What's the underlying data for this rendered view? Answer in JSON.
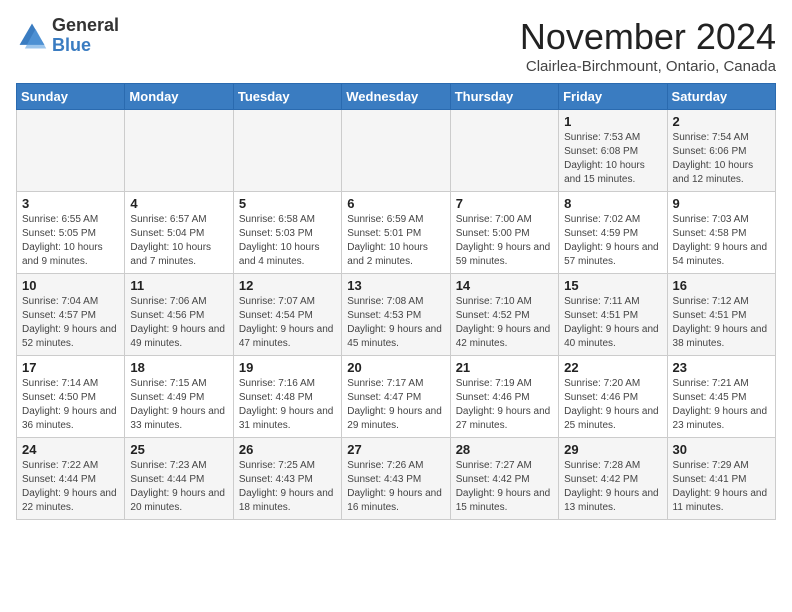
{
  "app": {
    "logo_general": "General",
    "logo_blue": "Blue"
  },
  "header": {
    "title": "November 2024",
    "location": "Clairlea-Birchmount, Ontario, Canada"
  },
  "columns": [
    "Sunday",
    "Monday",
    "Tuesday",
    "Wednesday",
    "Thursday",
    "Friday",
    "Saturday"
  ],
  "weeks": [
    [
      {
        "day": "",
        "info": ""
      },
      {
        "day": "",
        "info": ""
      },
      {
        "day": "",
        "info": ""
      },
      {
        "day": "",
        "info": ""
      },
      {
        "day": "",
        "info": ""
      },
      {
        "day": "1",
        "info": "Sunrise: 7:53 AM\nSunset: 6:08 PM\nDaylight: 10 hours and 15 minutes."
      },
      {
        "day": "2",
        "info": "Sunrise: 7:54 AM\nSunset: 6:06 PM\nDaylight: 10 hours and 12 minutes."
      }
    ],
    [
      {
        "day": "3",
        "info": "Sunrise: 6:55 AM\nSunset: 5:05 PM\nDaylight: 10 hours and 9 minutes."
      },
      {
        "day": "4",
        "info": "Sunrise: 6:57 AM\nSunset: 5:04 PM\nDaylight: 10 hours and 7 minutes."
      },
      {
        "day": "5",
        "info": "Sunrise: 6:58 AM\nSunset: 5:03 PM\nDaylight: 10 hours and 4 minutes."
      },
      {
        "day": "6",
        "info": "Sunrise: 6:59 AM\nSunset: 5:01 PM\nDaylight: 10 hours and 2 minutes."
      },
      {
        "day": "7",
        "info": "Sunrise: 7:00 AM\nSunset: 5:00 PM\nDaylight: 9 hours and 59 minutes."
      },
      {
        "day": "8",
        "info": "Sunrise: 7:02 AM\nSunset: 4:59 PM\nDaylight: 9 hours and 57 minutes."
      },
      {
        "day": "9",
        "info": "Sunrise: 7:03 AM\nSunset: 4:58 PM\nDaylight: 9 hours and 54 minutes."
      }
    ],
    [
      {
        "day": "10",
        "info": "Sunrise: 7:04 AM\nSunset: 4:57 PM\nDaylight: 9 hours and 52 minutes."
      },
      {
        "day": "11",
        "info": "Sunrise: 7:06 AM\nSunset: 4:56 PM\nDaylight: 9 hours and 49 minutes."
      },
      {
        "day": "12",
        "info": "Sunrise: 7:07 AM\nSunset: 4:54 PM\nDaylight: 9 hours and 47 minutes."
      },
      {
        "day": "13",
        "info": "Sunrise: 7:08 AM\nSunset: 4:53 PM\nDaylight: 9 hours and 45 minutes."
      },
      {
        "day": "14",
        "info": "Sunrise: 7:10 AM\nSunset: 4:52 PM\nDaylight: 9 hours and 42 minutes."
      },
      {
        "day": "15",
        "info": "Sunrise: 7:11 AM\nSunset: 4:51 PM\nDaylight: 9 hours and 40 minutes."
      },
      {
        "day": "16",
        "info": "Sunrise: 7:12 AM\nSunset: 4:51 PM\nDaylight: 9 hours and 38 minutes."
      }
    ],
    [
      {
        "day": "17",
        "info": "Sunrise: 7:14 AM\nSunset: 4:50 PM\nDaylight: 9 hours and 36 minutes."
      },
      {
        "day": "18",
        "info": "Sunrise: 7:15 AM\nSunset: 4:49 PM\nDaylight: 9 hours and 33 minutes."
      },
      {
        "day": "19",
        "info": "Sunrise: 7:16 AM\nSunset: 4:48 PM\nDaylight: 9 hours and 31 minutes."
      },
      {
        "day": "20",
        "info": "Sunrise: 7:17 AM\nSunset: 4:47 PM\nDaylight: 9 hours and 29 minutes."
      },
      {
        "day": "21",
        "info": "Sunrise: 7:19 AM\nSunset: 4:46 PM\nDaylight: 9 hours and 27 minutes."
      },
      {
        "day": "22",
        "info": "Sunrise: 7:20 AM\nSunset: 4:46 PM\nDaylight: 9 hours and 25 minutes."
      },
      {
        "day": "23",
        "info": "Sunrise: 7:21 AM\nSunset: 4:45 PM\nDaylight: 9 hours and 23 minutes."
      }
    ],
    [
      {
        "day": "24",
        "info": "Sunrise: 7:22 AM\nSunset: 4:44 PM\nDaylight: 9 hours and 22 minutes."
      },
      {
        "day": "25",
        "info": "Sunrise: 7:23 AM\nSunset: 4:44 PM\nDaylight: 9 hours and 20 minutes."
      },
      {
        "day": "26",
        "info": "Sunrise: 7:25 AM\nSunset: 4:43 PM\nDaylight: 9 hours and 18 minutes."
      },
      {
        "day": "27",
        "info": "Sunrise: 7:26 AM\nSunset: 4:43 PM\nDaylight: 9 hours and 16 minutes."
      },
      {
        "day": "28",
        "info": "Sunrise: 7:27 AM\nSunset: 4:42 PM\nDaylight: 9 hours and 15 minutes."
      },
      {
        "day": "29",
        "info": "Sunrise: 7:28 AM\nSunset: 4:42 PM\nDaylight: 9 hours and 13 minutes."
      },
      {
        "day": "30",
        "info": "Sunrise: 7:29 AM\nSunset: 4:41 PM\nDaylight: 9 hours and 11 minutes."
      }
    ]
  ]
}
